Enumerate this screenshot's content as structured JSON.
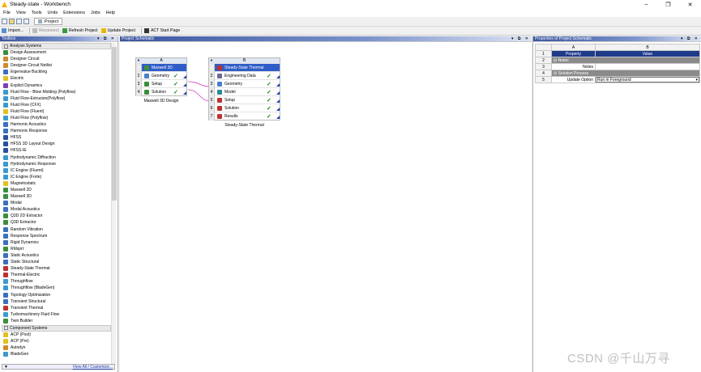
{
  "window": {
    "title": "Steady-state - Workbench",
    "minimize": "–",
    "maximize": "❐",
    "close": "✕"
  },
  "menu": [
    "File",
    "View",
    "Tools",
    "Units",
    "Extensions",
    "Jobs",
    "Help"
  ],
  "tab": {
    "label": "Project"
  },
  "toolbar2": {
    "import": "Import...",
    "reconnect": "Reconnect",
    "refresh": "Refresh Project",
    "update": "Update Project",
    "act": "ACT Start Page"
  },
  "toolbox": {
    "title": "Toolbox",
    "group1": "Analysis Systems",
    "items": [
      {
        "label": "Design Assessment",
        "color": "#3b8f3b"
      },
      {
        "label": "Designer Circuit",
        "color": "#d08a2a"
      },
      {
        "label": "Designer Circuit Netlist",
        "color": "#d08a2a"
      },
      {
        "label": "Eigenvalue Buckling",
        "color": "#3b6fc0"
      },
      {
        "label": "Electric",
        "color": "#e0c020"
      },
      {
        "label": "Explicit Dynamics",
        "color": "#7b3fb0"
      },
      {
        "label": "Fluid Flow - Blow Molding (Polyflow)",
        "color": "#3a9ad0"
      },
      {
        "label": "Fluid Flow-Extrusion(Polyflow)",
        "color": "#3a9ad0"
      },
      {
        "label": "Fluid Flow (CFX)",
        "color": "#3a9ad0"
      },
      {
        "label": "Fluid Flow (Fluent)",
        "color": "#e0c020"
      },
      {
        "label": "Fluid Flow (Polyflow)",
        "color": "#3a9ad0"
      },
      {
        "label": "Harmonic Acoustics",
        "color": "#3b6fc0"
      },
      {
        "label": "Harmonic Response",
        "color": "#3b6fc0"
      },
      {
        "label": "HFSS",
        "color": "#2a4fa0"
      },
      {
        "label": "HFSS 3D Layout Design",
        "color": "#2a4fa0"
      },
      {
        "label": "HFSS-IE",
        "color": "#2a4fa0"
      },
      {
        "label": "Hydrodynamic Diffraction",
        "color": "#3a9ad0"
      },
      {
        "label": "Hydrodynamic Response",
        "color": "#3a9ad0"
      },
      {
        "label": "IC Engine (Fluent)",
        "color": "#3a9ad0"
      },
      {
        "label": "IC Engine (Forte)",
        "color": "#3a9ad0"
      },
      {
        "label": "Magnetostatic",
        "color": "#e0c020"
      },
      {
        "label": "Maxwell 2D",
        "color": "#3b8f3b"
      },
      {
        "label": "Maxwell 3D",
        "color": "#3b8f3b"
      },
      {
        "label": "Modal",
        "color": "#3b6fc0"
      },
      {
        "label": "Modal Acoustics",
        "color": "#3b6fc0"
      },
      {
        "label": "Q3D 2D Extractor",
        "color": "#3b8f3b"
      },
      {
        "label": "Q3D Extractor",
        "color": "#3b8f3b"
      },
      {
        "label": "Random Vibration",
        "color": "#3b6fc0"
      },
      {
        "label": "Response Spectrum",
        "color": "#3b6fc0"
      },
      {
        "label": "Rigid Dynamics",
        "color": "#3b6fc0"
      },
      {
        "label": "RMxprt",
        "color": "#3b8f3b"
      },
      {
        "label": "Static Acoustics",
        "color": "#3b6fc0"
      },
      {
        "label": "Static Structural",
        "color": "#3b6fc0"
      },
      {
        "label": "Steady-State Thermal",
        "color": "#c03030"
      },
      {
        "label": "Thermal-Electric",
        "color": "#c03030"
      },
      {
        "label": "Throughflow",
        "color": "#3a9ad0"
      },
      {
        "label": "Throughflow (BladeGen)",
        "color": "#3a9ad0"
      },
      {
        "label": "Topology Optimization",
        "color": "#3b6fc0"
      },
      {
        "label": "Transient Structural",
        "color": "#3b6fc0"
      },
      {
        "label": "Transient Thermal",
        "color": "#c03030"
      },
      {
        "label": "Turbomachinery Fluid Flow",
        "color": "#3a9ad0"
      },
      {
        "label": "Twin Builder",
        "color": "#3b8f3b"
      }
    ],
    "group2": "Component Systems",
    "items2": [
      {
        "label": "ACP (Post)",
        "color": "#e0c020"
      },
      {
        "label": "ACP (Pre)",
        "color": "#e0c020"
      },
      {
        "label": "Autodyn",
        "color": "#d08a2a"
      },
      {
        "label": "BladeGen",
        "color": "#3a9ad0"
      }
    ],
    "footer": "View All / Customize..."
  },
  "schematic": {
    "title": "Project Schematic",
    "systemA": {
      "col": "A",
      "caption": "Maxwell 3D Design",
      "rows": [
        {
          "n": "1",
          "label": "Maxwell 3D",
          "status": "",
          "color": "#3b8f3b"
        },
        {
          "n": "2",
          "label": "Geometry",
          "status": "✓",
          "color": "#4a80c8"
        },
        {
          "n": "3",
          "label": "Setup",
          "status": "✓",
          "color": "#3b8f3b"
        },
        {
          "n": "4",
          "label": "Solution",
          "status": "✓",
          "color": "#3b8f3b"
        }
      ]
    },
    "systemB": {
      "col": "B",
      "caption": "Steady-State Thermal",
      "rows": [
        {
          "n": "1",
          "label": "Steady-State Thermal",
          "status": "",
          "color": "#c03030"
        },
        {
          "n": "2",
          "label": "Engineering Data",
          "status": "✓",
          "color": "#6a6a9a"
        },
        {
          "n": "3",
          "label": "Geometry",
          "status": "✓",
          "color": "#4a80c8"
        },
        {
          "n": "4",
          "label": "Model",
          "status": "✓",
          "color": "#2a8a9a"
        },
        {
          "n": "5",
          "label": "Setup",
          "status": "✓",
          "color": "#c03030"
        },
        {
          "n": "6",
          "label": "Solution",
          "status": "✓",
          "color": "#c03030"
        },
        {
          "n": "7",
          "label": "Results",
          "status": "✓",
          "color": "#c03030"
        }
      ]
    }
  },
  "properties": {
    "title": "Properties of Project Schematic",
    "colA": "A",
    "colB": "B",
    "rows": [
      {
        "n": "1",
        "a": "Property",
        "b": "Value"
      },
      {
        "n": "2",
        "a": "Notes",
        "b": ""
      },
      {
        "n": "3",
        "a": "Notes",
        "b": ""
      },
      {
        "n": "4",
        "a": "Solution Process",
        "b": ""
      },
      {
        "n": "5",
        "a": "Update Option",
        "b": "Run in Foreground"
      }
    ]
  },
  "watermark": "CSDN @千山万寻"
}
